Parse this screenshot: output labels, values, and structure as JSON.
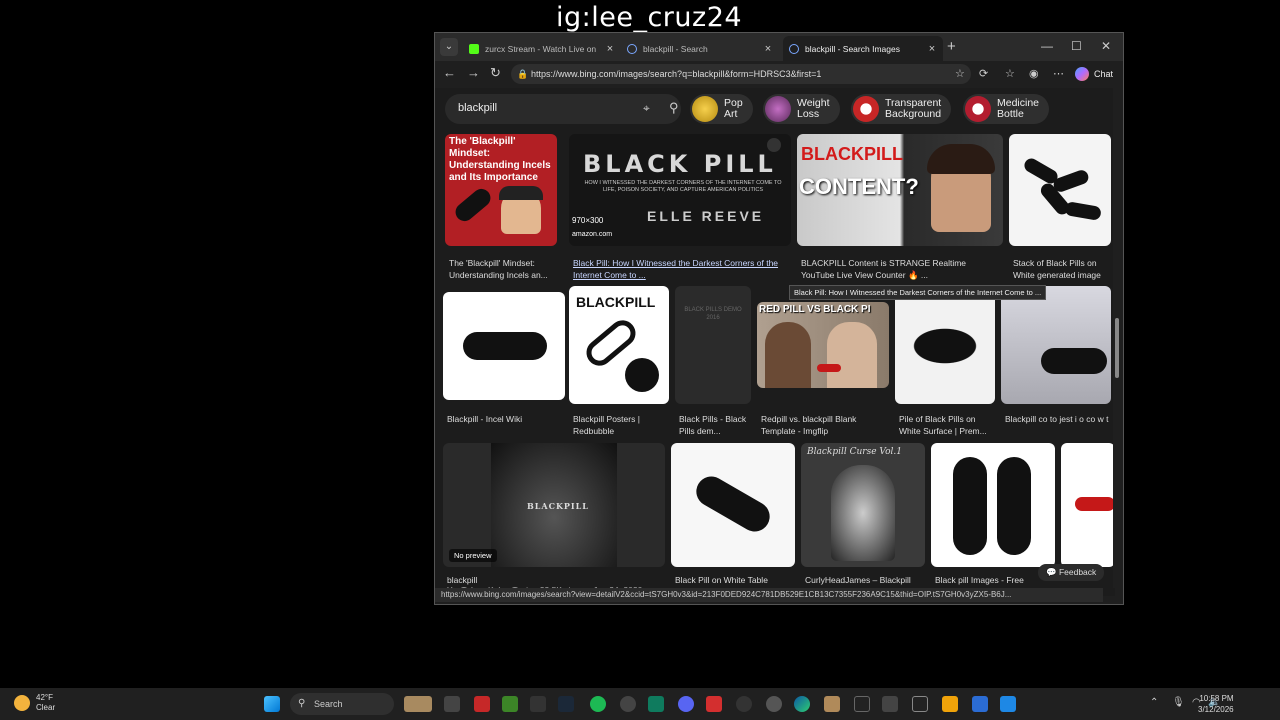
{
  "watermark": "ig:lee_cruz24",
  "browser": {
    "tabs": [
      {
        "title": "zurcx Stream - Watch Live on",
        "color": "#53fc18"
      },
      {
        "title": "blackpill - Search",
        "color": "#3a7bd5"
      },
      {
        "title": "blackpill - Search Images",
        "color": "#3a7bd5"
      }
    ],
    "url": "https://www.bing.com/images/search?q=blackpill&form=HDRSC3&first=1",
    "chat_label": "Chat",
    "search_query": "blackpill",
    "chips": [
      {
        "label": "Pop\nArt",
        "color": "#e6b800"
      },
      {
        "label": "Weight\nLoss",
        "color": "#9b4f9b"
      },
      {
        "label": "Transparent\nBackground",
        "color": "#c72626"
      },
      {
        "label": "Medicine\nBottle",
        "color": "#b31d2f"
      }
    ],
    "results": {
      "row1": [
        {
          "caption": "The 'Blackpill' Mindset: Understanding Incels an...",
          "overlay": "The 'Blackpill' Mindset: Understanding Incels and Its Importance"
        },
        {
          "caption": "Black Pill: How I Witnessed the Darkest Corners of the Internet Come to ...",
          "overlay": "BLACK PILL",
          "subtitle": "HOW I WITNESSED THE DARKEST CORNERS OF THE INTERNET COME TO LIFE, POISON SOCIETY, AND CAPTURE AMERICAN POLITICS",
          "author": "ELLE REEVE",
          "dims": "970×300",
          "source": "amazon.com"
        },
        {
          "caption": "BLACKPILL Content is STRANGE Realtime YouTube Live View Counter 🔥 ...",
          "overlay": "CONTENT?"
        },
        {
          "caption": "Stack of Black Pills on White generated image"
        }
      ],
      "row2": [
        {
          "caption": "Blackpill - Incel Wiki"
        },
        {
          "caption": "Blackpill Posters | Redbubble",
          "overlay": "BLACKPILL"
        },
        {
          "caption": "Black Pills - Black Pills dem..."
        },
        {
          "caption": "Redpill vs. blackpill Blank Template - Imgflip",
          "overlay": "RED PILL VS BLACK PI"
        },
        {
          "caption": "Pile of Black Pills on White Surface | Prem..."
        },
        {
          "caption": "Blackpill co to jest i o co w t"
        }
      ],
      "row3": [
        {
          "caption": "blackpill",
          "sub": "YouTube · Kala · Topic · 23.5K views · Jun 24, 2020",
          "overlay": "BLACKPILL",
          "badge": "No preview"
        },
        {
          "caption": "Black Pill on White Table"
        },
        {
          "caption": "CurlyHeadJames – Blackpill"
        },
        {
          "caption": "Black pill Images - Free"
        }
      ]
    },
    "tooltip": "Black Pill: How I Witnessed the Darkest Corners of the Internet Come to ...",
    "feedback_label": "Feedback",
    "status_url": "https://www.bing.com/images/search?view=detailV2&ccid=tS7GH0v3&id=213F0DED924C781DB529E1CB13C7355F236A9C15&thid=OIP.tS7GH0v3yZX5-B6J..."
  },
  "taskbar": {
    "temp": "42°F",
    "condition": "Clear",
    "search_label": "Search",
    "time": "10:58 PM",
    "date": "3/12/2026"
  }
}
